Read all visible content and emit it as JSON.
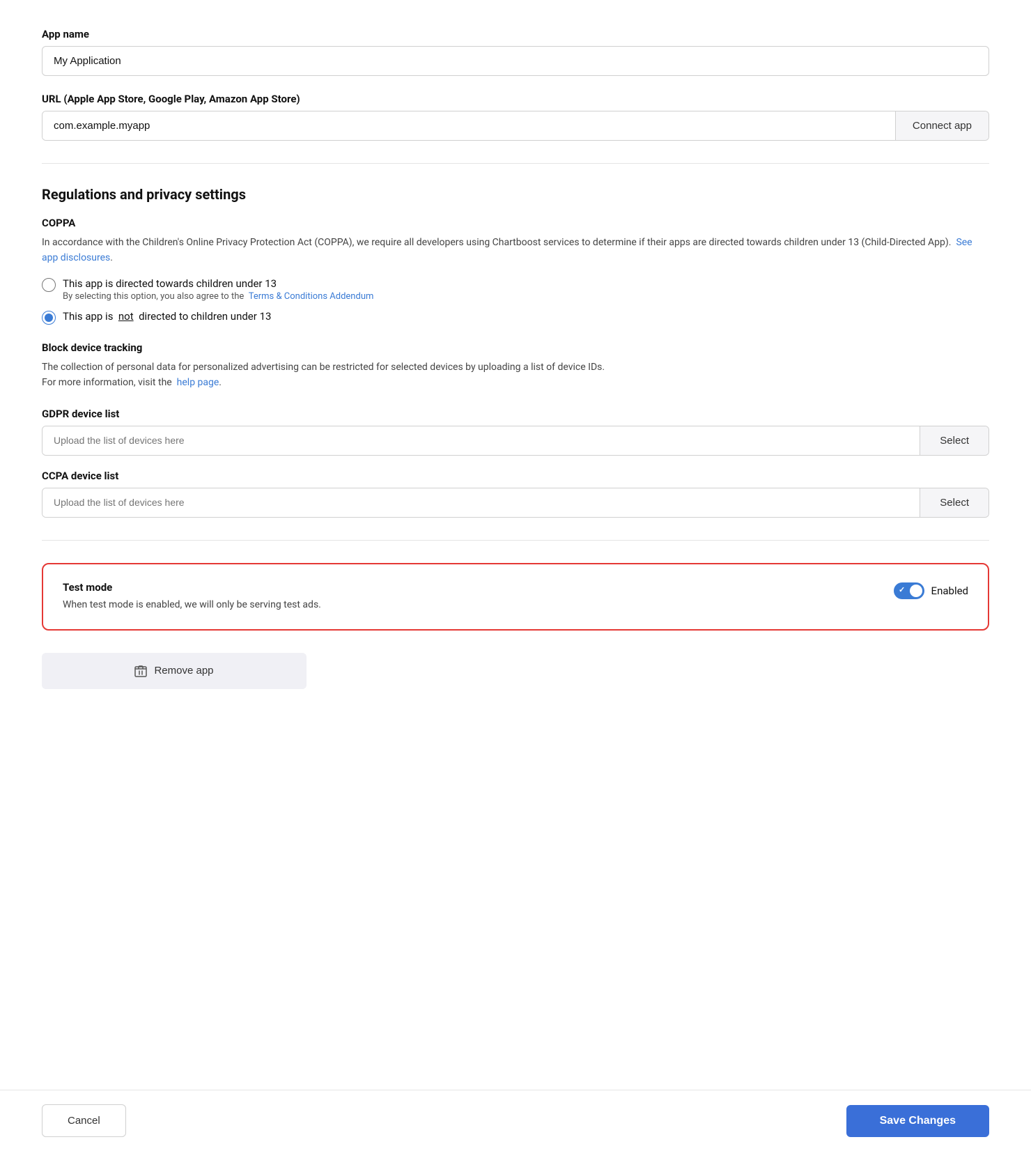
{
  "appName": {
    "label": "App name",
    "value": "My Application",
    "placeholder": "My Application"
  },
  "url": {
    "label": "URL (Apple App Store, Google Play, Amazon App Store)",
    "value": "com.example.myapp",
    "placeholder": "com.example.myapp",
    "connectButton": "Connect app"
  },
  "regulations": {
    "sectionTitle": "Regulations and privacy settings",
    "coppa": {
      "title": "COPPA",
      "description1": "In accordance with the Children's Online Privacy Protection Act (COPPA), we require all developers using Chartboost services to determine if their apps are directed towards children under 13 (Child-Directed App).",
      "seeAppDisclosures": "See app disclosures",
      "radio1Label": "This app is directed towards children under 13",
      "radio1SubLabel": "By selecting this option, you also agree to the",
      "termsLink": "Terms & Conditions Addendum",
      "radio2LabelPre": "This app is",
      "radio2LabelUnder": "not",
      "radio2LabelPost": "directed to children under 13",
      "radio1Checked": false,
      "radio2Checked": true
    },
    "blockTracking": {
      "title": "Block device tracking",
      "description1": "The collection of personal data for personalized advertising can be restricted for selected devices by uploading a list of device IDs.",
      "description2": "For more information, visit the",
      "helpLink": "help page"
    },
    "gdpr": {
      "label": "GDPR device list",
      "placeholder": "Upload the list of devices here",
      "selectButton": "Select"
    },
    "ccpa": {
      "label": "CCPA device list",
      "placeholder": "Upload the list of devices here",
      "selectButton": "Select"
    }
  },
  "testMode": {
    "title": "Test mode",
    "description": "When test mode is enabled, we will only be serving test ads.",
    "enabled": true,
    "enabledLabel": "Enabled"
  },
  "removeApp": {
    "label": "Remove app"
  },
  "footer": {
    "cancelLabel": "Cancel",
    "saveLabel": "Save Changes"
  }
}
